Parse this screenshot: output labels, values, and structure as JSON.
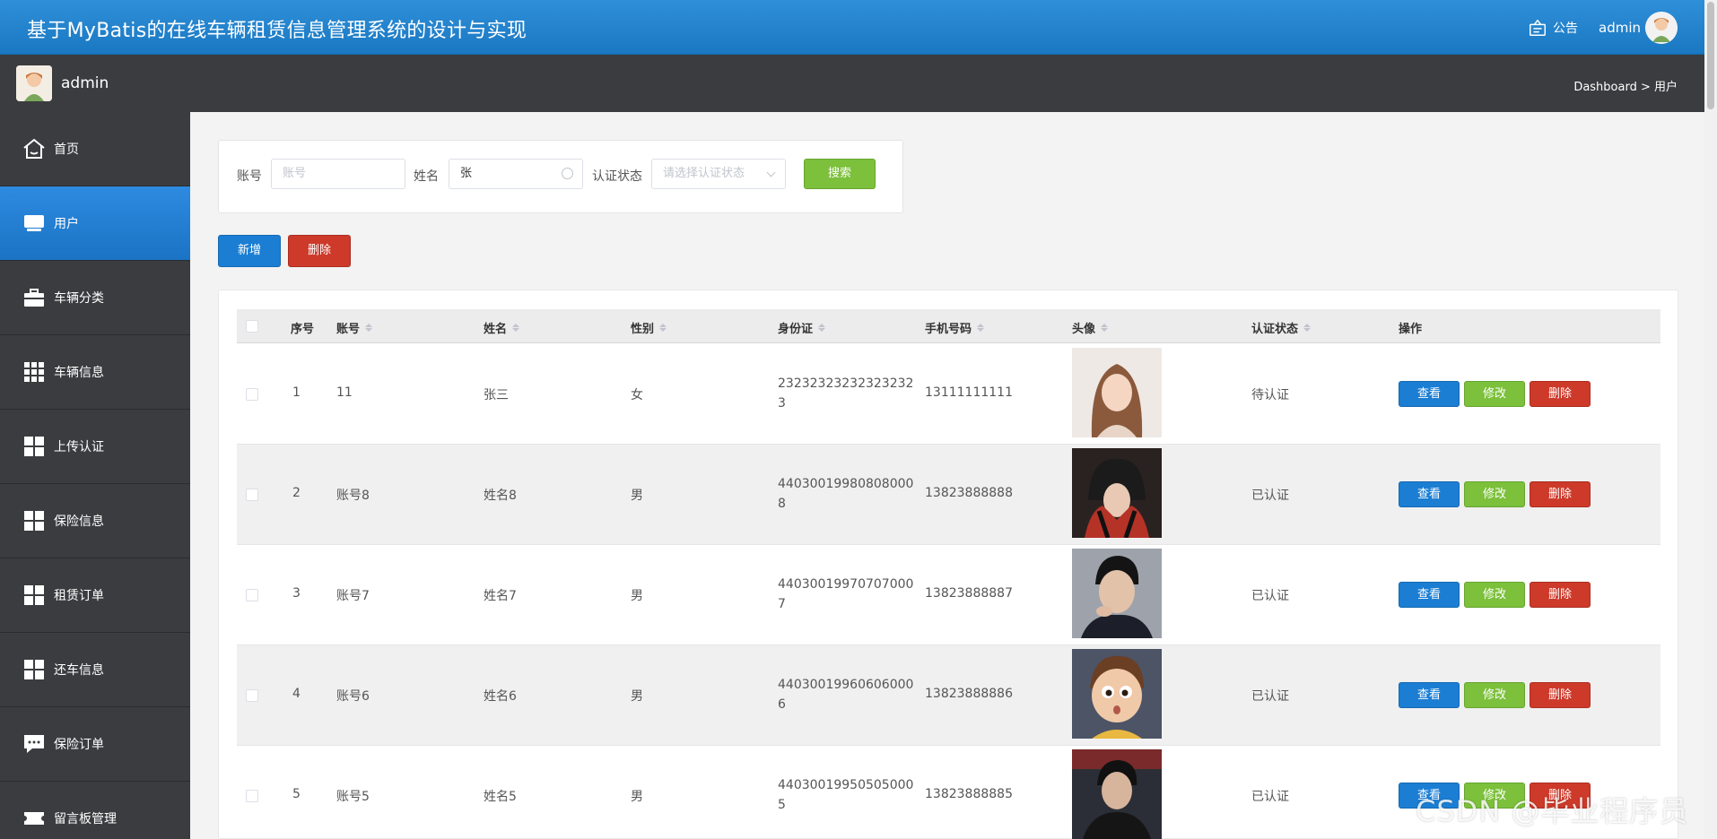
{
  "header": {
    "title": "基于MyBatis的在线车辆租赁信息管理系统的设计与实现",
    "notice": "公告",
    "user": "admin"
  },
  "subbar": {
    "name": "admin",
    "breadcrumb": "Dashboard > 用户"
  },
  "sidebar": {
    "items": [
      {
        "label": "首页",
        "icon": "home-icon"
      },
      {
        "label": "用户",
        "icon": "monitor-icon",
        "active": true
      },
      {
        "label": "车辆分类",
        "icon": "briefcase-icon"
      },
      {
        "label": "车辆信息",
        "icon": "grid-icon"
      },
      {
        "label": "上传认证",
        "icon": "grid4-icon"
      },
      {
        "label": "保险信息",
        "icon": "grid4-icon"
      },
      {
        "label": "租赁订单",
        "icon": "grid4-icon"
      },
      {
        "label": "还车信息",
        "icon": "grid4-icon"
      },
      {
        "label": "保险订单",
        "icon": "chat-icon"
      },
      {
        "label": "留言板管理",
        "icon": "ticket-icon"
      }
    ]
  },
  "search": {
    "account_label": "账号",
    "account_placeholder": "账号",
    "name_label": "姓名",
    "name_value": "张",
    "status_label": "认证状态",
    "status_placeholder": "请选择认证状态",
    "search_button": "搜索"
  },
  "actions": {
    "add": "新增",
    "delete": "删除"
  },
  "table": {
    "columns": [
      "序号",
      "账号",
      "姓名",
      "性别",
      "身份证",
      "手机号码",
      "头像",
      "认证状态",
      "操作"
    ],
    "rows": [
      {
        "no": "1",
        "account": "11",
        "name": "张三",
        "gender": "女",
        "id_line1": "23232323232323232",
        "id_line2": "3",
        "phone": "13111111111",
        "status": "待认证"
      },
      {
        "no": "2",
        "account": "账号8",
        "name": "姓名8",
        "gender": "男",
        "id_line1": "44030019980808000",
        "id_line2": "8",
        "phone": "13823888888",
        "status": "已认证"
      },
      {
        "no": "3",
        "account": "账号7",
        "name": "姓名7",
        "gender": "男",
        "id_line1": "44030019970707000",
        "id_line2": "7",
        "phone": "13823888887",
        "status": "已认证"
      },
      {
        "no": "4",
        "account": "账号6",
        "name": "姓名6",
        "gender": "男",
        "id_line1": "44030019960606000",
        "id_line2": "6",
        "phone": "13823888886",
        "status": "已认证"
      },
      {
        "no": "5",
        "account": "账号5",
        "name": "姓名5",
        "gender": "男",
        "id_line1": "44030019950505000",
        "id_line2": "5",
        "phone": "13823888885",
        "status": "已认证"
      }
    ],
    "row_actions": {
      "view": "查看",
      "edit": "修改",
      "delete": "删除"
    }
  },
  "watermark": "CSDN @毕业程序员",
  "colors": {
    "header": "#1a78c2",
    "sidebar": "#3a3c3f",
    "primary": "#1b7ed3",
    "success": "#7cc03b",
    "danger": "#cd3a2a"
  }
}
